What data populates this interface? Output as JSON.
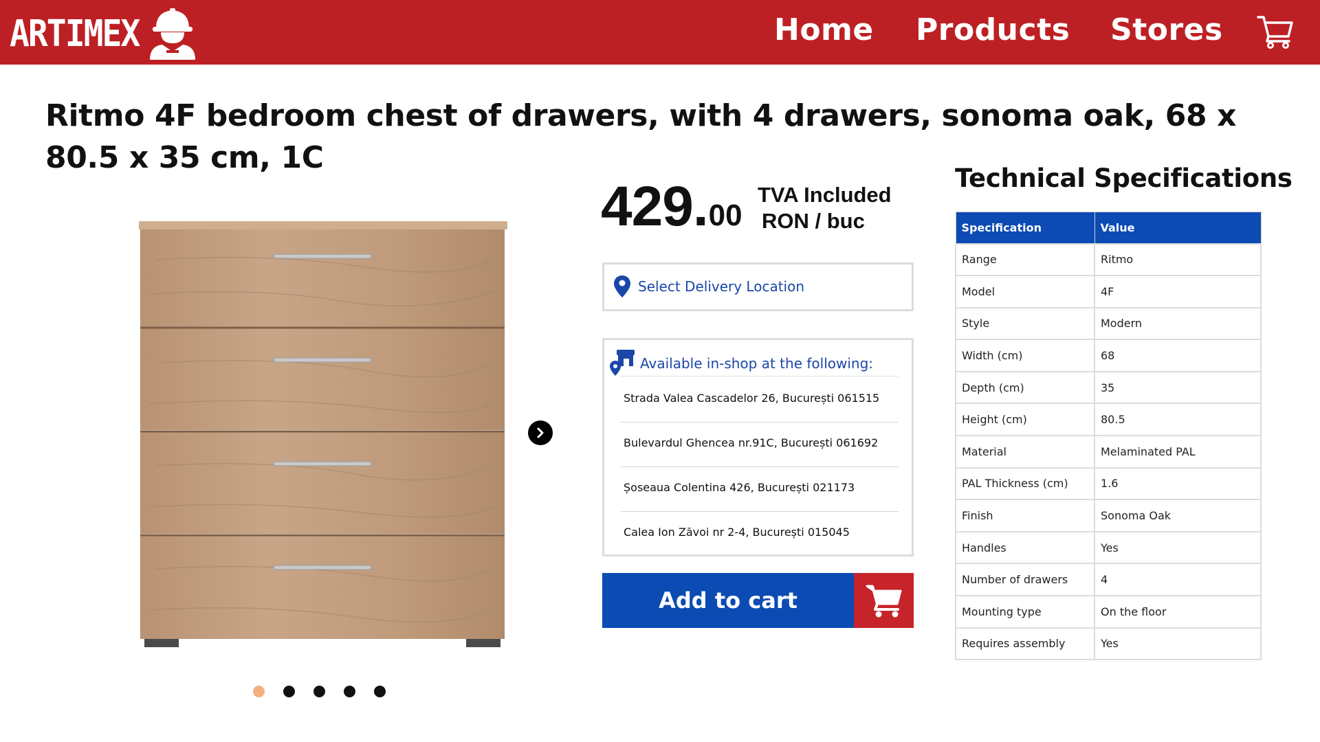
{
  "header": {
    "logo_text": "ARTIMEX",
    "nav": {
      "home": "Home",
      "products": "Products",
      "stores": "Stores"
    }
  },
  "product": {
    "title": "Ritmo 4F bedroom chest of drawers, with 4 drawers, sonoma oak, 68 x 80.5 x 35 cm, 1C",
    "price_integer": "429",
    "price_separator": ".",
    "price_decimals": "00",
    "tva_label": "TVA Included",
    "unit_label": "RON / buc",
    "image_count": 5,
    "active_image": 1
  },
  "delivery": {
    "label": "Select Delivery Location"
  },
  "shops": {
    "heading": "Available in-shop at the following:",
    "addresses": [
      "Strada Valea Cascadelor 26, București 061515",
      "Bulevardul Ghencea nr.91C, București 061692",
      "Șoseaua Colentina 426, București 021173",
      "Calea Ion Zăvoi nr 2-4, București 015045"
    ]
  },
  "cart_button": {
    "label": "Add to cart"
  },
  "specs": {
    "title": "Technical Specifications",
    "col_spec": "Specification",
    "col_value": "Value",
    "rows": [
      {
        "name": "Range",
        "value": "Ritmo"
      },
      {
        "name": "Model",
        "value": "4F"
      },
      {
        "name": "Style",
        "value": "Modern"
      },
      {
        "name": "Width (cm)",
        "value": "68"
      },
      {
        "name": "Depth (cm)",
        "value": "35"
      },
      {
        "name": "Height (cm)",
        "value": "80.5"
      },
      {
        "name": "Material",
        "value": "Melaminated PAL"
      },
      {
        "name": "PAL Thickness (cm)",
        "value": "1.6"
      },
      {
        "name": "Finish",
        "value": "Sonoma Oak"
      },
      {
        "name": "Handles",
        "value": "Yes"
      },
      {
        "name": "Number of drawers",
        "value": "4"
      },
      {
        "name": "Mounting type",
        "value": "On the floor"
      },
      {
        "name": "Requires assembly",
        "value": "Yes"
      }
    ]
  },
  "colors": {
    "header_red": "#bd2024",
    "primary_blue": "#0b4bb3",
    "cart_red": "#c6232a",
    "link_blue": "#1a47a8",
    "active_dot": "#f3b07f"
  }
}
